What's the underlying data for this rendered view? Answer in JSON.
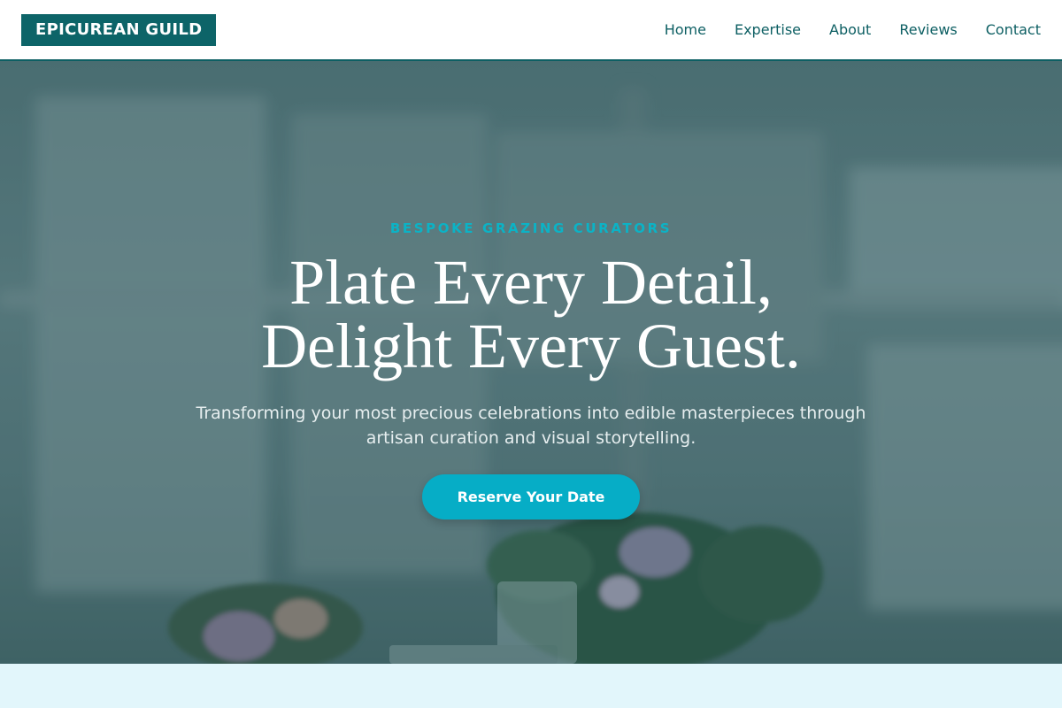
{
  "brand": {
    "logo_text": "EPICUREAN GUILD"
  },
  "nav": {
    "links": [
      {
        "label": "Home"
      },
      {
        "label": "Expertise"
      },
      {
        "label": "About"
      },
      {
        "label": "Reviews"
      },
      {
        "label": "Contact"
      }
    ]
  },
  "hero": {
    "eyebrow": "BESPOKE GRAZING CURATORS",
    "headline_line1": "Plate Every Detail,",
    "headline_line2": "Delight Every Guest.",
    "subtitle": "Transforming your most precious celebrations into edible masterpieces through artisan curation and visual storytelling.",
    "cta_label": "Reserve Your Date"
  },
  "colors": {
    "brand_teal": "#0d6468",
    "accent_cyan": "#06adc6",
    "section_bg": "#e2f6fb"
  }
}
